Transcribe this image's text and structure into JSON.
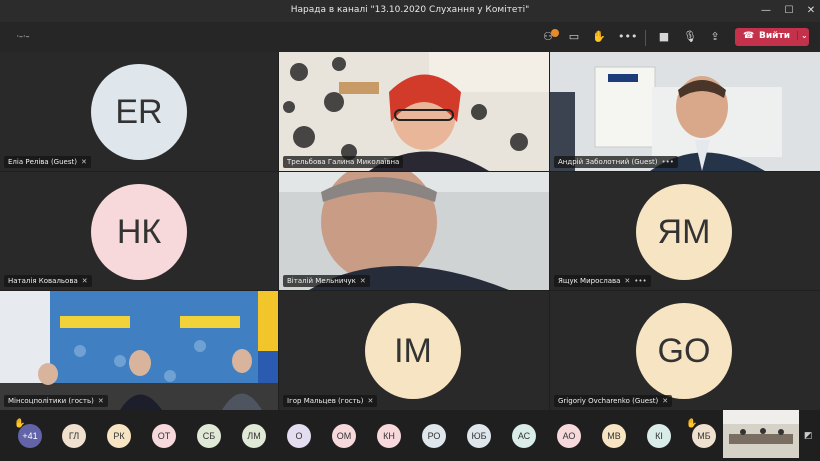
{
  "window": {
    "title": "Нарада в каналі \"13.10.2020 Слухання у Комітеті\""
  },
  "toolbar": {
    "timer": "·–·–",
    "participants_badge": "",
    "leave_label": "Вийти",
    "icons": [
      "participants-icon",
      "chat-icon",
      "raise-hand-icon",
      "more-icon",
      "camera-icon",
      "mic-icon",
      "share-icon"
    ]
  },
  "tiles": [
    {
      "name": "Еліа Реліва (Guest)",
      "initials": "ER",
      "color": "#dfe6ec",
      "type": "avatar"
    },
    {
      "name": "Трельбова Галина Миколаївна",
      "type": "video"
    },
    {
      "name": "Андрій Заболотний (Guest)",
      "type": "video"
    },
    {
      "name": "Наталія Ковальова",
      "initials": "НК",
      "color": "#f7d9dc",
      "type": "avatar"
    },
    {
      "name": "Віталій Мельничук",
      "type": "video"
    },
    {
      "name": "Ящук Мирослава",
      "initials": "ЯМ",
      "color": "#f6e4c2",
      "type": "avatar"
    },
    {
      "name": "Мінсоцполітики (гость)",
      "type": "video"
    },
    {
      "name": "Ігор Мальцев (гость)",
      "initials": "IM",
      "color": "#f6e4c2",
      "type": "avatar"
    },
    {
      "name": "Grigoriy Ovcharenko (Guest)",
      "initials": "GO",
      "color": "#f6e4c2",
      "type": "avatar"
    }
  ],
  "bottom": {
    "more_count": "+41",
    "participants": [
      {
        "initials": "ГЛ",
        "color": "#f0e1cf"
      },
      {
        "initials": "РК",
        "color": "#f6e4c2"
      },
      {
        "initials": "ОТ",
        "color": "#f7d9dc"
      },
      {
        "initials": "СБ",
        "color": "#e0e8d6"
      },
      {
        "initials": "ЛМ",
        "color": "#e0e8d6"
      },
      {
        "initials": "О",
        "color": "#e4dcef"
      },
      {
        "initials": "ОМ",
        "color": "#f7d9dc"
      },
      {
        "initials": "КН",
        "color": "#f7d9dc"
      },
      {
        "initials": "РО",
        "color": "#dfe6ec"
      },
      {
        "initials": "ЮБ",
        "color": "#dfe6ec"
      },
      {
        "initials": "АС",
        "color": "#d9ece8"
      },
      {
        "initials": "АО",
        "color": "#f7d9dc"
      },
      {
        "initials": "МВ",
        "color": "#f6e4c2"
      },
      {
        "initials": "КІ",
        "color": "#d9ece8"
      },
      {
        "initials": "МБ",
        "color": "#f0e1cf"
      }
    ]
  }
}
